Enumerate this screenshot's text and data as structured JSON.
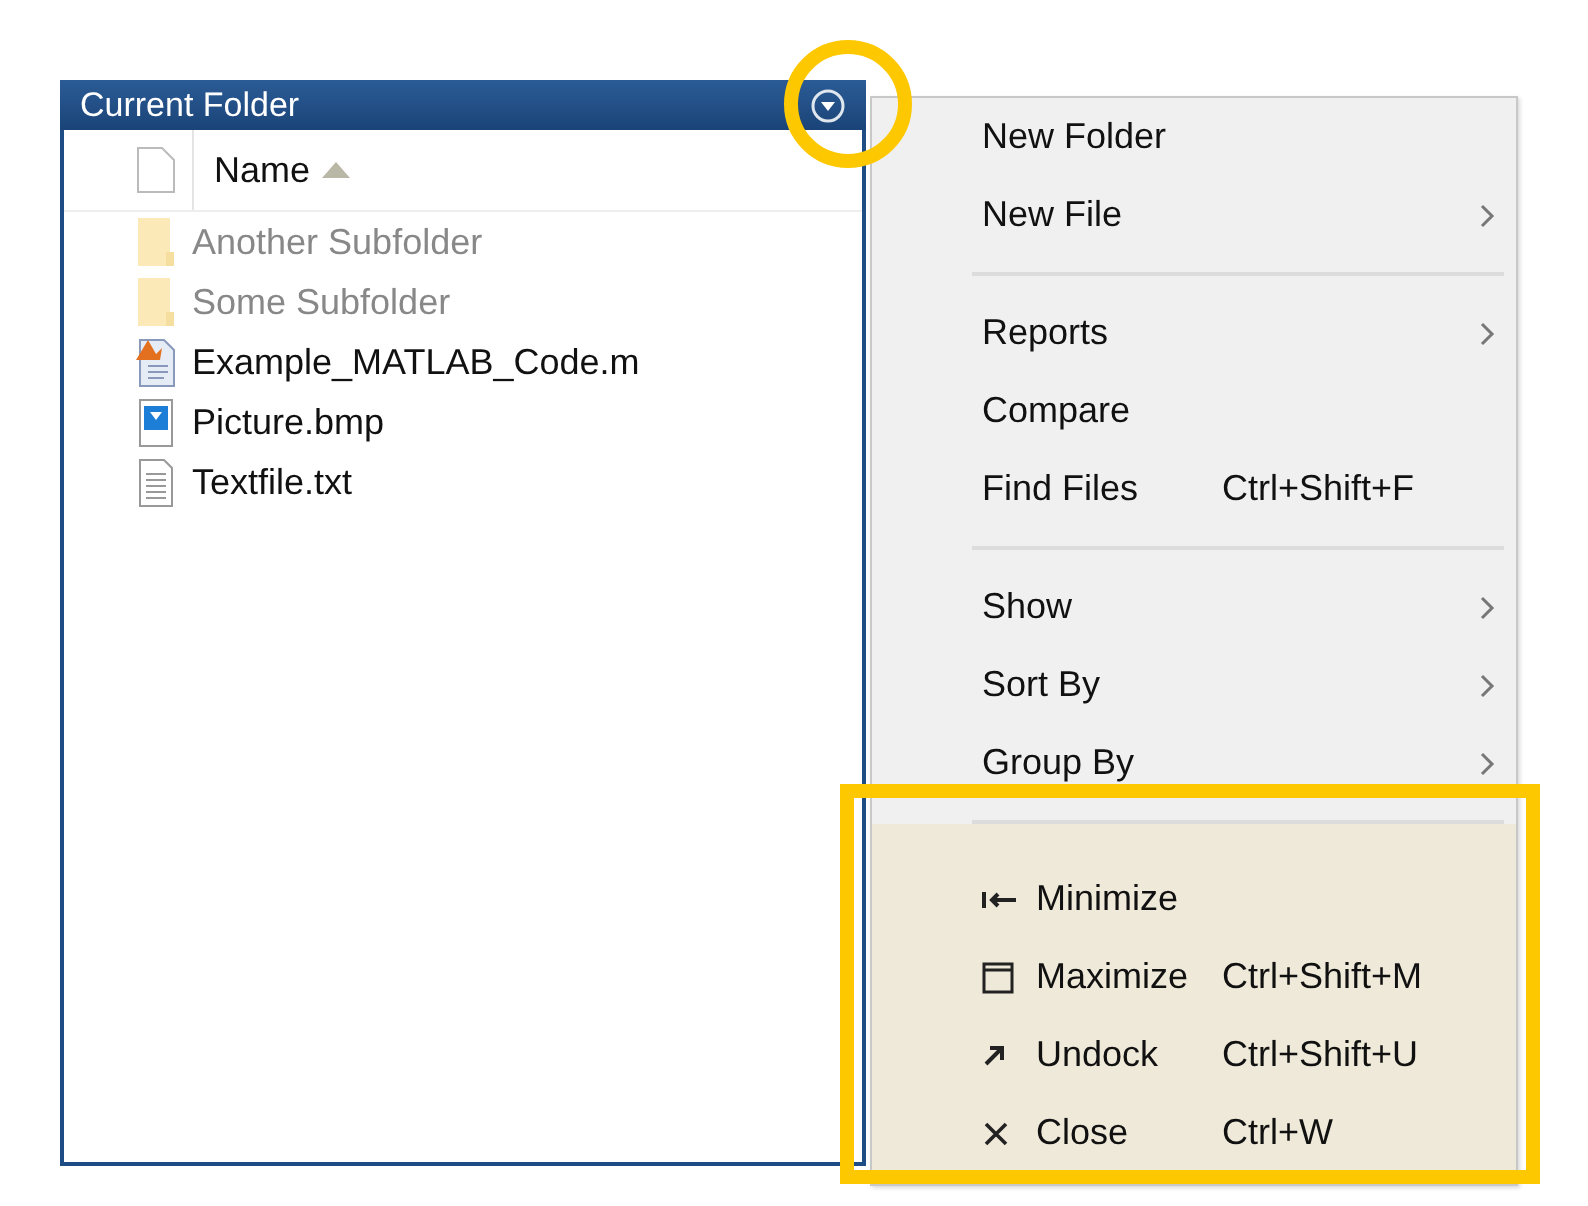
{
  "panel": {
    "title": "Current Folder",
    "column": "Name",
    "files": [
      {
        "name": "Another Subfolder",
        "kind": "folder"
      },
      {
        "name": "Some Subfolder",
        "kind": "folder"
      },
      {
        "name": "Example_MATLAB_Code.m",
        "kind": "mfile"
      },
      {
        "name": "Picture.bmp",
        "kind": "image"
      },
      {
        "name": "Textfile.txt",
        "kind": "text"
      }
    ]
  },
  "menu": {
    "groups": [
      [
        {
          "label": "New Folder",
          "submenu": false
        },
        {
          "label": "New File",
          "submenu": true
        }
      ],
      [
        {
          "label": "Reports",
          "submenu": true
        },
        {
          "label": "Compare",
          "submenu": false
        },
        {
          "label": "Find Files",
          "shortcut": "Ctrl+Shift+F",
          "submenu": false
        }
      ],
      [
        {
          "label": "Show",
          "submenu": true
        },
        {
          "label": "Sort By",
          "submenu": true
        },
        {
          "label": "Group By",
          "submenu": true
        }
      ]
    ],
    "window_items": [
      {
        "label": "Minimize",
        "kind": "minimize"
      },
      {
        "label": "Maximize",
        "kind": "maximize",
        "shortcut": "Ctrl+Shift+M"
      },
      {
        "label": "Undock",
        "kind": "undock",
        "shortcut": "Ctrl+Shift+U"
      },
      {
        "label": "Close",
        "kind": "close",
        "shortcut": "Ctrl+W"
      }
    ]
  }
}
